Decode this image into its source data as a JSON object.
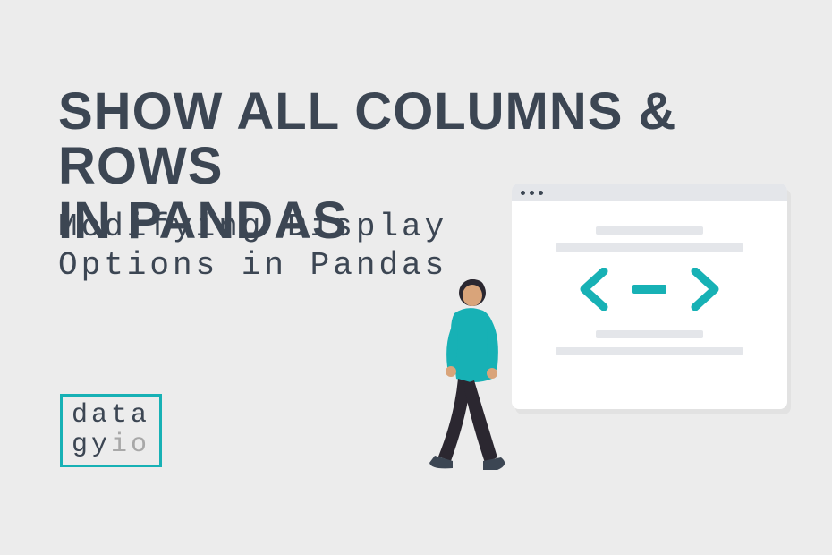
{
  "heading_line1": "SHOW ALL COLUMNS & ROWS",
  "heading_line2": "IN PANDAS",
  "subheading_line1": "Modifying Display",
  "subheading_line2": "Options in Pandas",
  "logo": {
    "line1": "data",
    "line2a": "gy",
    "line2b": "io"
  },
  "colors": {
    "accent": "#17b1b5",
    "dark": "#3c4653",
    "bg": "#ececec"
  }
}
